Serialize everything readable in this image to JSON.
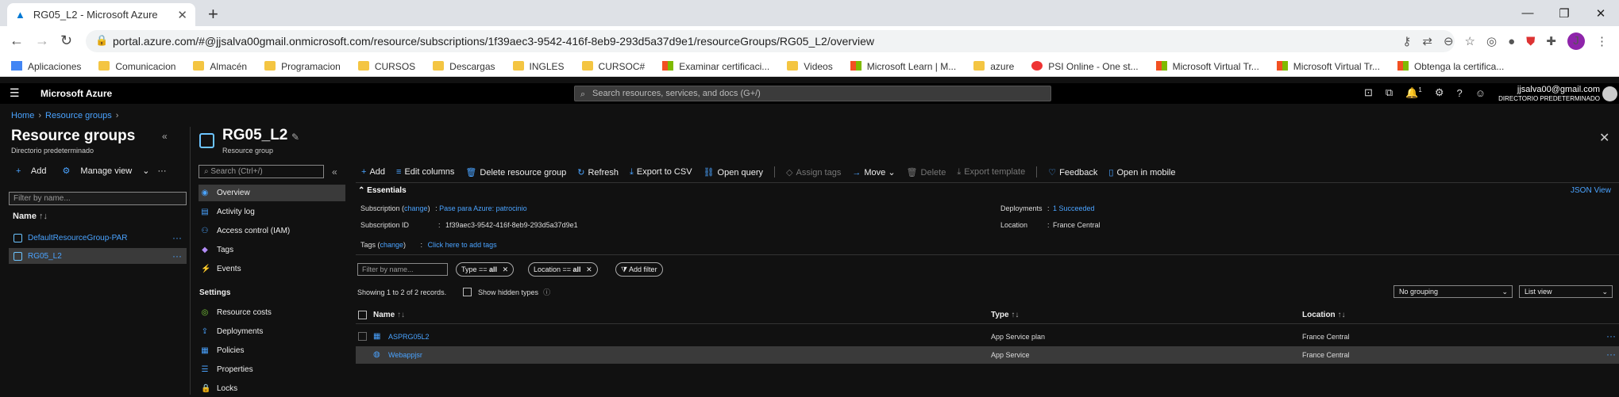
{
  "browser": {
    "tab_title": "RG05_L2 - Microsoft Azure",
    "url": "portal.azure.com/#@jjsalva00gmail.onmicrosoft.com/resource/subscriptions/1f39aec3-9542-416f-8eb9-293d5a37d9e1/resourceGroups/RG05_L2/overview",
    "profile_initial": "J",
    "bookmarks": [
      "Aplicaciones",
      "Comunicacion",
      "Almacén",
      "Programacion",
      "CURSOS",
      "Descargas",
      "INGLES",
      "CURSOC#",
      "Examinar certificaci...",
      "Videos",
      "Microsoft Learn | M...",
      "azure",
      "PSI Online - One st...",
      "Microsoft Virtual Tr...",
      "Microsoft Virtual Tr...",
      "Obtenga la certifica..."
    ]
  },
  "azure": {
    "brand": "Microsoft Azure",
    "search_placeholder": "Search resources, services, and docs (G+/)",
    "notification_count": "1",
    "user_email": "jjsalva00@gmail.com",
    "user_directory": "DIRECTORIO PREDETERMINADO"
  },
  "breadcrumb": [
    "Home",
    "Resource groups"
  ],
  "left_pane": {
    "title": "Resource groups",
    "subtitle": "Directorio predeterminado",
    "add_label": "Add",
    "manage_view_label": "Manage view",
    "filter_placeholder": "Filter by name...",
    "column_name": "Name",
    "items": [
      "DefaultResourceGroup-PAR",
      "RG05_L2"
    ]
  },
  "resource": {
    "title": "RG05_L2",
    "subtitle": "Resource group"
  },
  "menu": {
    "search_placeholder": "Search (Ctrl+/)",
    "items": [
      "Overview",
      "Activity log",
      "Access control (IAM)",
      "Tags",
      "Events"
    ],
    "settings_header": "Settings",
    "settings_items": [
      "Resource costs",
      "Deployments",
      "Policies",
      "Properties",
      "Locks"
    ]
  },
  "commands": {
    "add": "Add",
    "edit_columns": "Edit columns",
    "delete_rg": "Delete resource group",
    "refresh": "Refresh",
    "export_csv": "Export to CSV",
    "open_query": "Open query",
    "assign_tags": "Assign tags",
    "move": "Move",
    "delete": "Delete",
    "export_template": "Export template",
    "feedback": "Feedback",
    "open_mobile": "Open in mobile"
  },
  "essentials": {
    "title": "Essentials",
    "json_view": "JSON View",
    "subscription_label": "Subscription",
    "change": "change",
    "subscription_value": "Pase para Azure: patrocinio",
    "subscription_id_label": "Subscription ID",
    "subscription_id_value": "1f39aec3-9542-416f-8eb9-293d5a37d9e1",
    "tags_label": "Tags",
    "tags_value": "Click here to add tags",
    "deployments_label": "Deployments",
    "deployments_value": "1 Succeeded",
    "location_label": "Location",
    "location_value": "France Central"
  },
  "filters": {
    "name_placeholder": "Filter by name...",
    "type_label": "Type == ",
    "type_value": "all",
    "location_label": "Location == ",
    "location_value": "all",
    "add_filter": "Add filter",
    "showing": "Showing 1 to 2 of 2 records.",
    "show_hidden": "Show hidden types",
    "grouping": "No grouping",
    "view": "List view"
  },
  "table": {
    "columns": [
      "Name",
      "Type",
      "Location"
    ],
    "rows": [
      {
        "name": "ASPRG05L2",
        "type": "App Service plan",
        "location": "France Central"
      },
      {
        "name": "Webappjsr",
        "type": "App Service",
        "location": "France Central"
      }
    ]
  }
}
